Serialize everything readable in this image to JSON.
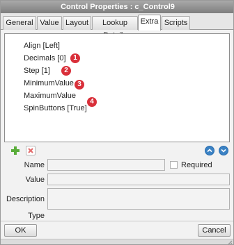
{
  "window": {
    "title": "Control Properties : c_Control9"
  },
  "tabs": [
    {
      "label": "General"
    },
    {
      "label": "Value"
    },
    {
      "label": "Layout"
    },
    {
      "label": "Lookup Details"
    },
    {
      "label": "Extra",
      "active": true
    },
    {
      "label": "Scripts"
    }
  ],
  "property_list": [
    {
      "label": "Align [Left]"
    },
    {
      "label": "Decimals [0]",
      "badge": "1"
    },
    {
      "label": "Step [1]",
      "badge": "2"
    },
    {
      "label": "MinimumValue"
    },
    {
      "label": "MaximumValue"
    },
    {
      "label": "SpinButtons [True]",
      "badge": "4"
    }
  ],
  "group_badge": "3",
  "toolbar_icons": {
    "add": "add-icon",
    "delete": "delete-icon",
    "move_up": "arrow-up-icon",
    "move_down": "arrow-down-icon"
  },
  "form": {
    "name_label": "Name",
    "name_value": "",
    "required_label": "Required",
    "required_checked": false,
    "value_label": "Value",
    "value_value": "",
    "description_label": "Description",
    "description_value": "",
    "type_label": "Type",
    "type_value": ""
  },
  "buttons": {
    "ok": "OK",
    "cancel": "Cancel"
  },
  "colors": {
    "badge": "#d9303a",
    "add_icon": "#5aad3a",
    "delete_icon": "#e36b6b",
    "arrow_icon": "#3b82c4"
  }
}
